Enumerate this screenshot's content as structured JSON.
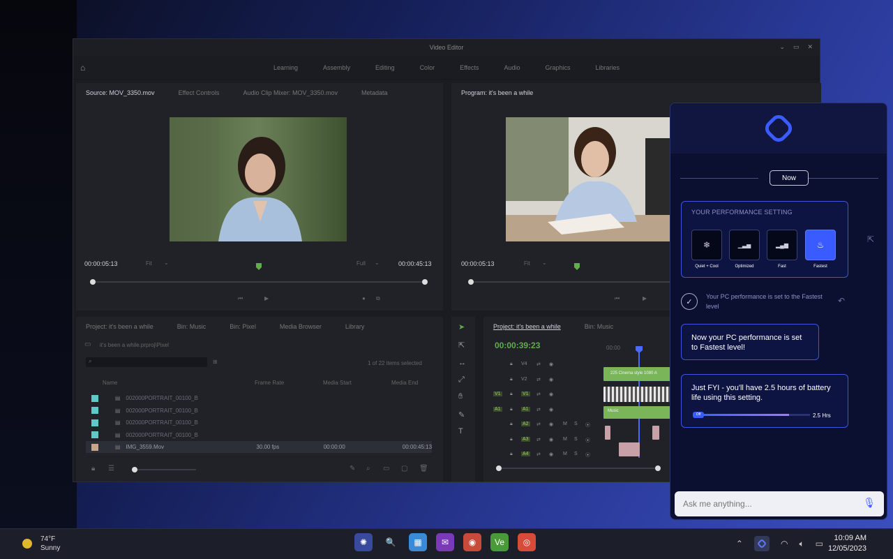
{
  "editor": {
    "title": "Video Editor",
    "menu": [
      "Learning",
      "Assembly",
      "Editing",
      "Color",
      "Effects",
      "Audio",
      "Graphics",
      "Libraries"
    ],
    "source_tabs": [
      "Source: MOV_3350.mov",
      "Effect Controls",
      "Audio Clip Mixer: MOV_3350.mov",
      "Metadata"
    ],
    "program_tab": "Program: it's been a while",
    "source_tc_in": "00:00:05:13",
    "source_fit": "Fit",
    "source_full": "Full",
    "source_tc_out": "00:00:45:13",
    "program_tc_in": "00:00:05:13",
    "program_fit": "Fit",
    "project_tabs": [
      "Project: it's been a while",
      "Bin: Music",
      "Bin: Pixel",
      "Media Browser",
      "Library"
    ],
    "project_path": "it's been a while.prproj\\Pixel",
    "items_selected": "1 of 22 items selected",
    "columns": [
      "Name",
      "Frame Rate",
      "Media Start",
      "Media End"
    ],
    "rows": [
      {
        "name": "002000PORTRAIT_00100_B",
        "rate": "",
        "start": "",
        "end": "",
        "color": "#5fc8c8"
      },
      {
        "name": "002000PORTRAIT_00100_B",
        "rate": "",
        "start": "",
        "end": "",
        "color": "#5fc8c8"
      },
      {
        "name": "002000PORTRAIT_00100_B",
        "rate": "",
        "start": "",
        "end": "",
        "color": "#5fc8c8"
      },
      {
        "name": "002000PORTRAIT_00100_B",
        "rate": "",
        "start": "",
        "end": "",
        "color": "#5fc8c8"
      },
      {
        "name": "IMG_3559.Mov",
        "rate": "30.00 fps",
        "start": "00:00:00",
        "end": "00:00:45:13",
        "color": "#c8a68a"
      }
    ],
    "timeline_tabs": [
      "Project: it's been a while",
      "Bin: Music"
    ],
    "timeline_tc": "00:00:39:23",
    "ruler_start": "00:00",
    "tracks": [
      "V4",
      "V2",
      "V1",
      "A1",
      "A2",
      "A3",
      "A4"
    ],
    "track_tags": [
      "V1",
      "A1"
    ],
    "clip_labels": [
      "225 Cinema style 1080 A",
      "Music"
    ]
  },
  "assistant": {
    "now_label": "Now",
    "perf_title": "YOUR PERFORMANCE SETTING",
    "modes": [
      {
        "label": "Quiet + Cool",
        "icon": "❄"
      },
      {
        "label": "Optimized",
        "icon": "▁▃▅"
      },
      {
        "label": "Fast",
        "icon": "▂▄▆"
      },
      {
        "label": "Fastest",
        "icon": "♨"
      }
    ],
    "active_mode": "Fastest",
    "status_text": "Your PC performance is set to the Fastest level",
    "message1": "Now your PC performance is set to Fastest level!",
    "message2": "Just FYI - you'll have 2.5 hours of battery life using this setting.",
    "battery_pill": "Off",
    "battery_label": "2.5 Hrs",
    "battery_fraction": 0.82,
    "ask_placeholder": "Ask me anything...",
    "accent": "#3a5bff"
  },
  "taskbar": {
    "temp": "74°F",
    "condition": "Sunny",
    "time": "10:09 AM",
    "date": "12/05/2023",
    "apps": [
      {
        "name": "settings-app-icon",
        "glyph": "✺",
        "bg": "#3a4a9a"
      },
      {
        "name": "search-icon",
        "glyph": "🔍",
        "bg": "transparent"
      },
      {
        "name": "photos-app-icon",
        "glyph": "▦",
        "bg": "#3a8ad8"
      },
      {
        "name": "mail-app-icon",
        "glyph": "✉",
        "bg": "#7a3ab8"
      },
      {
        "name": "browser-app-icon",
        "glyph": "◉",
        "bg": "#c84a3a"
      },
      {
        "name": "video-editor-app-icon",
        "glyph": "Ve",
        "bg": "#4a9a3a"
      },
      {
        "name": "camera-app-icon",
        "glyph": "◎",
        "bg": "#d84a3a"
      }
    ]
  }
}
